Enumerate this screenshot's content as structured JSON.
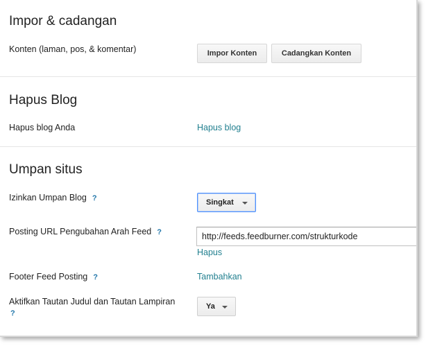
{
  "import_backup": {
    "title": "Impor & cadangan",
    "content_label": "Konten (laman, pos, & komentar)",
    "import_button": "Impor Konten",
    "backup_button": "Cadangkan Konten"
  },
  "delete_blog": {
    "title": "Hapus Blog",
    "label": "Hapus blog Anda",
    "link": "Hapus blog"
  },
  "site_feed": {
    "title": "Umpan situs",
    "help_glyph": "?",
    "allow_feed": {
      "label": "Izinkan Umpan Blog",
      "value": "Singkat"
    },
    "redirect_url": {
      "label": "Posting URL Pengubahan Arah Feed",
      "value": "http://feeds.feedburner.com/strukturkode",
      "delete_link": "Hapus"
    },
    "footer_feed": {
      "label": "Footer Feed Posting",
      "link": "Tambahkan"
    },
    "title_links": {
      "label": "Aktifkan Tautan Judul dan Tautan Lampiran",
      "value": "Ya"
    }
  },
  "colors": {
    "link": "#217f8f",
    "help": "#2277aa",
    "focus": "#4d90fe"
  }
}
